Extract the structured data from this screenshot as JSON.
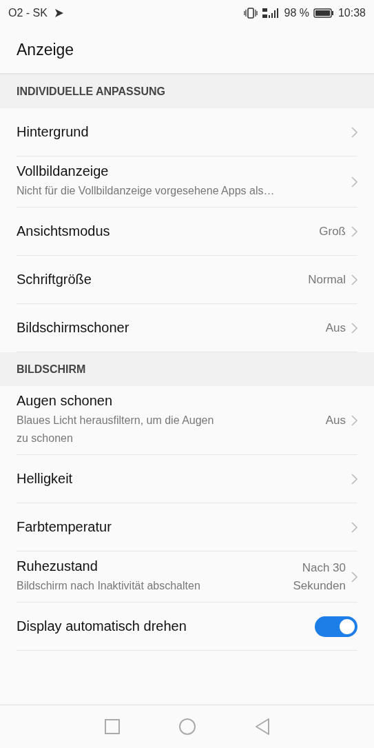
{
  "status_bar": {
    "carrier": "O2 - SK",
    "battery": "98 %",
    "time": "10:38"
  },
  "title": "Anzeige",
  "sections": [
    {
      "header": "INDIVIDUELLE ANPASSUNG",
      "items": [
        {
          "kind": "nav",
          "title": "Hintergrund"
        },
        {
          "kind": "nav",
          "title": "Vollbildanzeige",
          "subtitle": "Nicht für die Vollbildanzeige vorgesehene Apps als…"
        },
        {
          "kind": "nav",
          "title": "Ansichtsmodus",
          "value": "Groß"
        },
        {
          "kind": "nav",
          "title": "Schriftgröße",
          "value": "Normal"
        },
        {
          "kind": "nav",
          "title": "Bildschirmschoner",
          "value": "Aus"
        }
      ]
    },
    {
      "header": "BILDSCHIRM",
      "items": [
        {
          "kind": "nav",
          "title": "Augen schonen",
          "subtitle": "Blaues Licht herausfiltern, um die Augen zu schonen",
          "value": "Aus"
        },
        {
          "kind": "nav",
          "title": "Helligkeit"
        },
        {
          "kind": "nav",
          "title": "Farbtemperatur"
        },
        {
          "kind": "nav",
          "title": "Ruhezustand",
          "subtitle": "Bildschirm nach Inaktivität abschalten",
          "value": "Nach 30 Sekunden"
        },
        {
          "kind": "toggle",
          "title": "Display automatisch drehen",
          "on": true
        }
      ]
    }
  ]
}
